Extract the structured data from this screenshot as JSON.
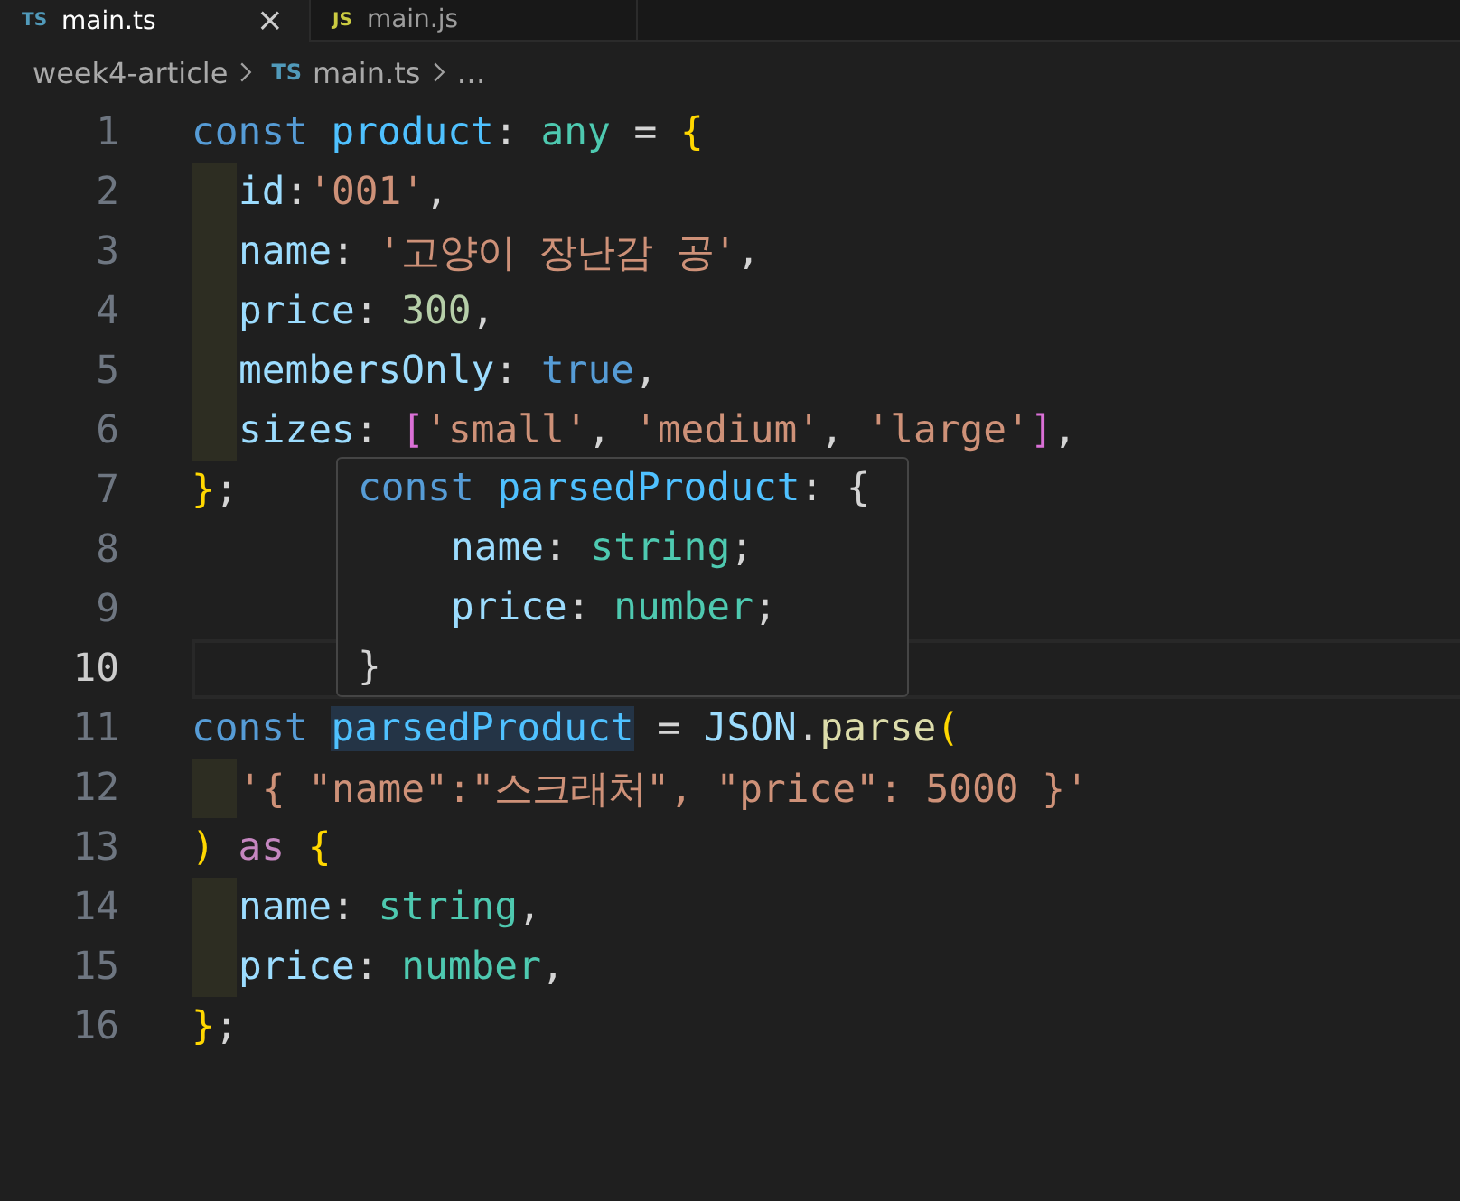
{
  "tabs": [
    {
      "label": "main.ts",
      "icon_text": "TS",
      "color": "#519aba",
      "selected": true,
      "close": "×"
    },
    {
      "label": "main.js",
      "icon_text": "JS",
      "color": "#cbcb41",
      "selected": false
    }
  ],
  "breadcrumb": [
    {
      "label": "week4-article"
    },
    {
      "label": "main.ts",
      "icon_text": "TS"
    },
    {
      "label": "…"
    }
  ],
  "lines": [
    {
      "number": "1",
      "indented": false,
      "current": false,
      "tokens": [
        {
          "kind": "keyword",
          "text": "const "
        },
        {
          "kind": "variable",
          "text": "product"
        },
        {
          "kind": "punct",
          "text": ": "
        },
        {
          "kind": "type",
          "text": "any"
        },
        {
          "kind": "punct",
          "text": " = "
        },
        {
          "kind": "brace",
          "text": "{"
        }
      ]
    },
    {
      "number": "2",
      "indented": true,
      "current": false,
      "tokens": [
        {
          "kind": "property",
          "text": "id"
        },
        {
          "kind": "punct",
          "text": ":"
        },
        {
          "kind": "string",
          "text": "'001'"
        },
        {
          "kind": "punct",
          "text": ","
        }
      ]
    },
    {
      "number": "3",
      "indented": true,
      "current": false,
      "tokens": [
        {
          "kind": "property",
          "text": "name"
        },
        {
          "kind": "punct",
          "text": ": "
        },
        {
          "kind": "string",
          "text": "'고양이 장난감 공'"
        },
        {
          "kind": "punct",
          "text": ","
        }
      ]
    },
    {
      "number": "4",
      "indented": true,
      "current": false,
      "tokens": [
        {
          "kind": "property",
          "text": "price"
        },
        {
          "kind": "punct",
          "text": ": "
        },
        {
          "kind": "number",
          "text": "300"
        },
        {
          "kind": "punct",
          "text": ","
        }
      ]
    },
    {
      "number": "5",
      "indented": true,
      "current": false,
      "tokens": [
        {
          "kind": "property",
          "text": "membersOnly"
        },
        {
          "kind": "punct",
          "text": ": "
        },
        {
          "kind": "keyword",
          "text": "true"
        },
        {
          "kind": "punct",
          "text": ","
        }
      ]
    },
    {
      "number": "6",
      "indented": true,
      "current": false,
      "tokens": [
        {
          "kind": "property",
          "text": "sizes"
        },
        {
          "kind": "punct",
          "text": ": "
        },
        {
          "kind": "bracket",
          "text": "["
        },
        {
          "kind": "string",
          "text": "'small'"
        },
        {
          "kind": "punct",
          "text": ", "
        },
        {
          "kind": "string",
          "text": "'medium'"
        },
        {
          "kind": "punct",
          "text": ", "
        },
        {
          "kind": "string",
          "text": "'large'"
        },
        {
          "kind": "bracket",
          "text": "]"
        },
        {
          "kind": "punct",
          "text": ","
        }
      ]
    },
    {
      "number": "7",
      "indented": false,
      "current": false,
      "tokens": [
        {
          "kind": "brace",
          "text": "}"
        },
        {
          "kind": "punct",
          "text": ";"
        }
      ]
    },
    {
      "number": "8",
      "indented": false,
      "current": false
    },
    {
      "number": "9",
      "indented": false,
      "current": false
    },
    {
      "number": "10",
      "indented": false,
      "current": true
    },
    {
      "number": "11",
      "indented": false,
      "current": false,
      "tokens": [
        {
          "kind": "keyword",
          "text": "const "
        },
        {
          "kind": "variable",
          "text": "parsedProduct",
          "highlighted": true
        },
        {
          "kind": "punct",
          "text": " = "
        },
        {
          "kind": "class",
          "text": "JSON"
        },
        {
          "kind": "punct",
          "text": "."
        },
        {
          "kind": "function",
          "text": "parse"
        },
        {
          "kind": "brace",
          "text": "("
        }
      ]
    },
    {
      "number": "12",
      "indented": true,
      "current": false,
      "tokens": [
        {
          "kind": "string",
          "text": "'{ \"name\":\"스크래처\", \"price\": 5000 }'"
        }
      ]
    },
    {
      "number": "13",
      "indented": false,
      "current": false,
      "tokens": [
        {
          "kind": "brace",
          "text": ")"
        },
        {
          "kind": "control",
          "text": " as "
        },
        {
          "kind": "brace",
          "text": "{"
        }
      ]
    },
    {
      "number": "14",
      "indented": true,
      "current": false,
      "tokens": [
        {
          "kind": "property",
          "text": "name"
        },
        {
          "kind": "punct",
          "text": ": "
        },
        {
          "kind": "type",
          "text": "string"
        },
        {
          "kind": "punct",
          "text": ","
        }
      ]
    },
    {
      "number": "15",
      "indented": true,
      "current": false,
      "tokens": [
        {
          "kind": "property",
          "text": "price"
        },
        {
          "kind": "punct",
          "text": ": "
        },
        {
          "kind": "type",
          "text": "number"
        },
        {
          "kind": "punct",
          "text": ","
        }
      ]
    },
    {
      "number": "16",
      "indented": false,
      "current": false,
      "tokens": [
        {
          "kind": "brace",
          "text": "}"
        },
        {
          "kind": "punct",
          "text": ";"
        }
      ]
    }
  ],
  "hover": {
    "lines": [
      {
        "tokens": [
          {
            "kind": "keyword",
            "text": "const "
          },
          {
            "kind": "variable",
            "text": "parsedProduct"
          },
          {
            "kind": "punct",
            "text": ": {"
          }
        ]
      },
      {
        "tokens": [
          {
            "kind": "property",
            "text": "    name"
          },
          {
            "kind": "punct",
            "text": ": "
          },
          {
            "kind": "type",
            "text": "string"
          },
          {
            "kind": "punct",
            "text": ";"
          }
        ]
      },
      {
        "tokens": [
          {
            "kind": "property",
            "text": "    price"
          },
          {
            "kind": "punct",
            "text": ": "
          },
          {
            "kind": "type",
            "text": "number"
          },
          {
            "kind": "punct",
            "text": ";"
          }
        ]
      },
      {
        "tokens": [
          {
            "kind": "punct",
            "text": "}"
          }
        ]
      }
    ]
  }
}
